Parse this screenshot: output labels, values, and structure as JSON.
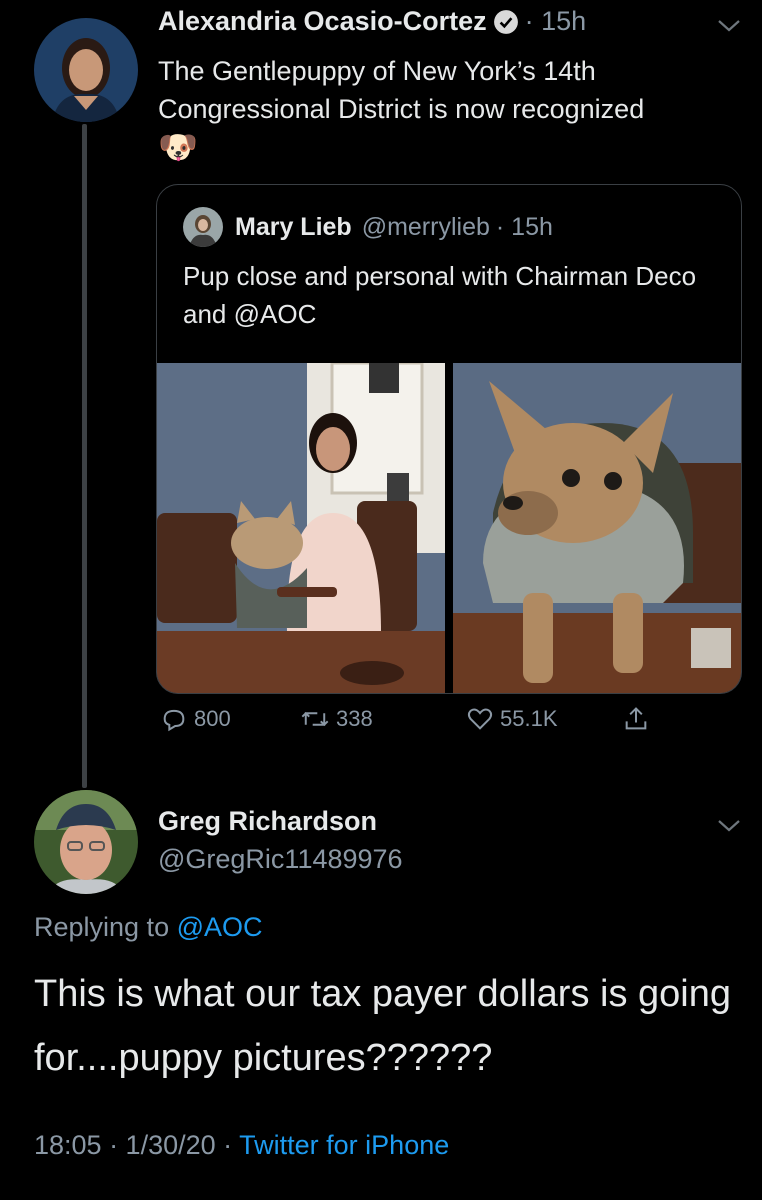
{
  "tweet": {
    "author_name": "Alexandria Ocasio-Cortez",
    "time": "· 15h",
    "text": "The Gentlepuppy of New York’s 14th Congressional District is now recognized",
    "emoji": "🐶",
    "verified_icon": "verified-badge-icon",
    "quote": {
      "author_name": "Mary Lieb",
      "handle": "@merrylieb",
      "time": "· 15h",
      "text": "Pup close and personal with Chairman Deco and @AOC"
    },
    "actions": {
      "replies": "800",
      "retweets": "338",
      "likes": "55.1K"
    }
  },
  "reply_tweet": {
    "author_name": "Greg Richardson",
    "handle": "@GregRic11489976",
    "replying_to_label": "Replying to",
    "replying_to_handle": "@AOC",
    "text": "This is what our tax payer dollars is going for....puppy pictures??????",
    "timestamp": "18:05 · 1/30/20 ·",
    "source": "Twitter for iPhone"
  },
  "colors": {
    "background": "#000000",
    "text": "#e7e9ea",
    "muted": "#8b98a5",
    "link": "#1d9bf0"
  }
}
